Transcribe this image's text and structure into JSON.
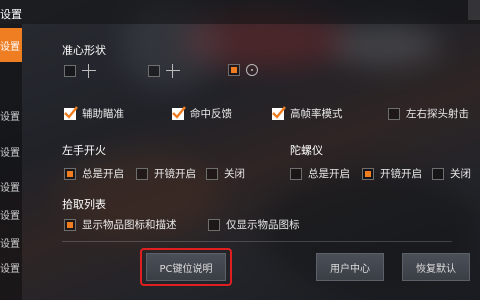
{
  "window": {
    "title": "设置"
  },
  "sidebar": {
    "items": [
      {
        "label": "设置",
        "active": true
      },
      {
        "label": "设置",
        "active": false
      },
      {
        "label": "设置",
        "active": false
      },
      {
        "label": "设置",
        "active": false
      },
      {
        "label": "设置",
        "active": false
      },
      {
        "label": "设置",
        "active": false
      },
      {
        "label": "设置",
        "active": false
      }
    ]
  },
  "crosshair": {
    "title": "准心形状",
    "options": [
      {
        "icon": "crosshair-plus-small-icon",
        "selected": false
      },
      {
        "icon": "crosshair-plus-large-icon",
        "selected": false
      },
      {
        "icon": "crosshair-dot-circle-icon",
        "selected": true
      }
    ]
  },
  "assist": {
    "options": [
      {
        "label": "辅助瞄准",
        "checked": true
      },
      {
        "label": "命中反馈",
        "checked": true
      },
      {
        "label": "高帧率模式",
        "checked": true
      },
      {
        "label": "左右探头射击",
        "checked": false
      }
    ]
  },
  "left_fire": {
    "title": "左手开火",
    "options": [
      {
        "label": "总是开启",
        "selected": true
      },
      {
        "label": "开镜开启",
        "selected": false
      },
      {
        "label": "关闭",
        "selected": false
      }
    ]
  },
  "gyro": {
    "title": "陀螺仪",
    "options": [
      {
        "label": "总是开启",
        "selected": false
      },
      {
        "label": "开镜开启",
        "selected": true
      },
      {
        "label": "关闭",
        "selected": false
      }
    ]
  },
  "pickup": {
    "title": "拾取列表",
    "options": [
      {
        "label": "显示物品图标和描述",
        "selected": true
      },
      {
        "label": "仅显示物品图标",
        "selected": false
      }
    ]
  },
  "buttons": {
    "pc_keys": "PC键位说明",
    "user_center": "用户中心",
    "restore_default": "恢复默认"
  },
  "colors": {
    "accent": "#ef7d22",
    "highlight": "#e02020"
  }
}
